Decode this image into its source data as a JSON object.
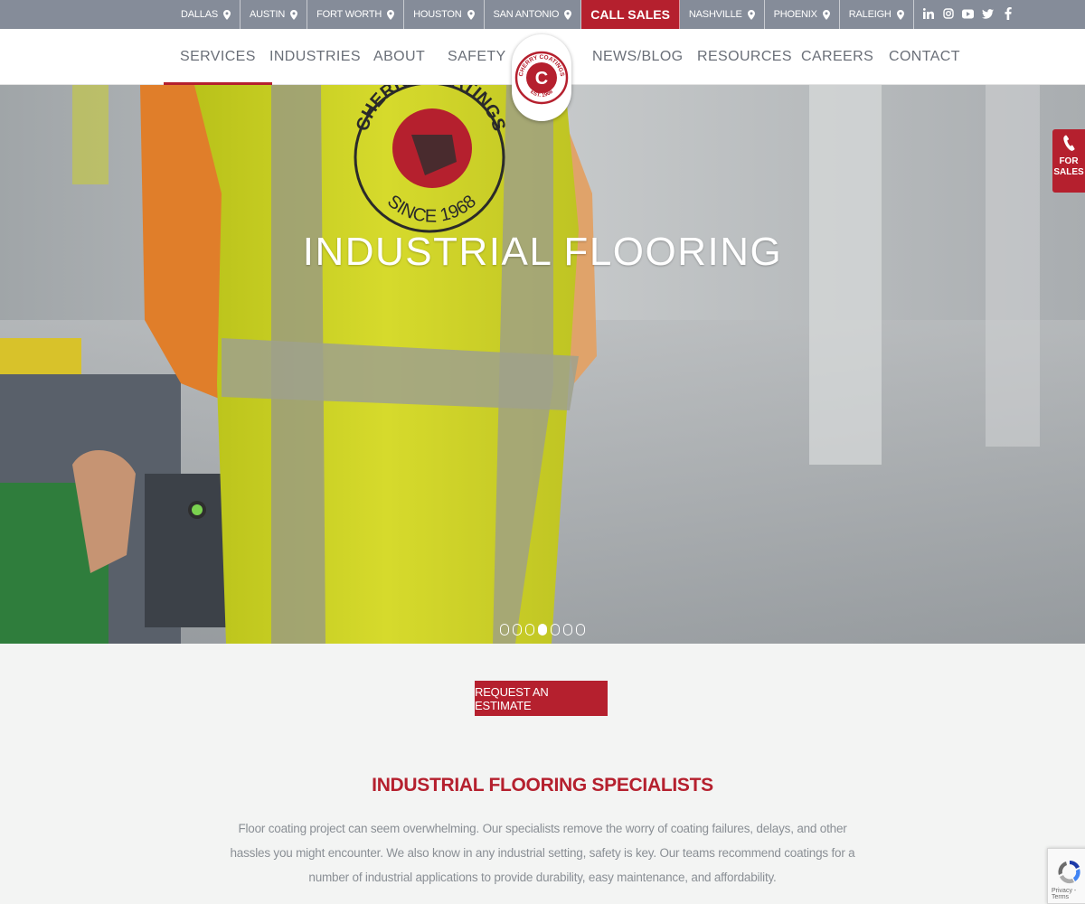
{
  "topbar": {
    "locations": [
      "DALLAS",
      "AUSTIN",
      "FORT WORTH",
      "HOUSTON",
      "SAN ANTONIO"
    ],
    "call_sales": "CALL SALES",
    "locations_right": [
      "NASHVILLE",
      "PHOENIX",
      "RALEIGH"
    ],
    "social_icons": [
      "linkedin-icon",
      "instagram-icon",
      "youtube-icon",
      "twitter-icon",
      "facebook-icon"
    ]
  },
  "nav": {
    "items_left": [
      "SERVICES",
      "INDUSTRIES",
      "ABOUT",
      "SAFETY"
    ],
    "items_right": [
      "NEWS/BLOG",
      "RESOURCES",
      "CAREERS",
      "CONTACT"
    ],
    "active": "SERVICES"
  },
  "logo": {
    "text_top": "CHERRY COATINGS",
    "text_bottom": "EST. 1968",
    "letter": "C"
  },
  "hero": {
    "title": "INDUSTRIAL FLOORING",
    "vest_text_top": "CHERRY COATINGS",
    "vest_text_bottom": "SINCE 1968",
    "slides_total": 7,
    "active_slide": 4
  },
  "for_sales": {
    "line1": "FOR",
    "line2": "SALES"
  },
  "cta": {
    "estimate_label": "REQUEST AN ESTIMATE"
  },
  "content": {
    "title": "INDUSTRIAL FLOORING SPECIALISTS",
    "body": "Floor coating project can seem overwhelming. Our specialists remove the worry of coating failures, delays, and other hassles you might encounter. We also know in any industrial setting, safety is key. Our teams recommend coatings for a number of industrial applications to provide durability, easy maintenance, and affordability."
  },
  "recaptcha": {
    "label": "Privacy - Terms"
  },
  "colors": {
    "brand_red": "#b5202e",
    "topbar": "#858c99",
    "nav_text": "#6a6f78",
    "page_bg": "#f3f4f3"
  }
}
